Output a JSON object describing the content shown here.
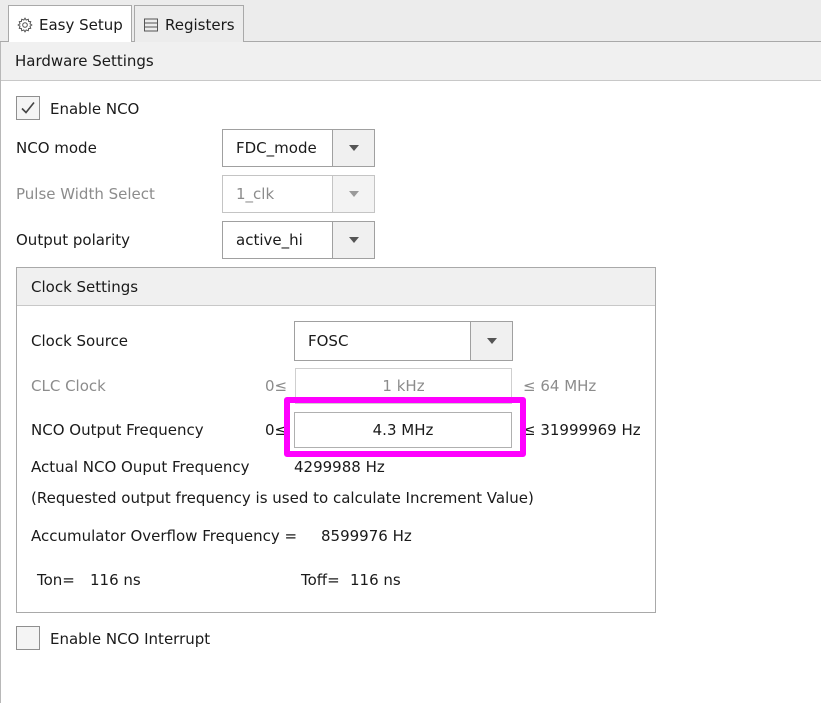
{
  "tabs": [
    {
      "label": "Easy Setup",
      "icon": "gear-icon",
      "active": true
    },
    {
      "label": "Registers",
      "icon": "list-icon",
      "active": false
    }
  ],
  "hardware": {
    "header": "Hardware Settings",
    "enable_nco": {
      "label": "Enable NCO",
      "checked": true
    },
    "nco_mode": {
      "label": "NCO mode",
      "value": "FDC_mode"
    },
    "pulse_width": {
      "label": "Pulse Width Select",
      "value": "1_clk",
      "disabled": true
    },
    "output_polarity": {
      "label": "Output polarity",
      "value": "active_hi"
    }
  },
  "clock": {
    "header": "Clock Settings",
    "source": {
      "label": "Clock Source",
      "value": "FOSC"
    },
    "clc_clock": {
      "label": "CLC Clock",
      "min": "0≤",
      "value": "1 kHz",
      "max": "≤ 64 MHz",
      "disabled": true
    },
    "nco_freq": {
      "label": "NCO Output Frequency",
      "min": "0≤",
      "value": "4.3 MHz",
      "max": "≤ 31999969 Hz"
    },
    "actual": {
      "label": "Actual NCO Ouput Frequency",
      "value": "4299988 Hz"
    },
    "note": "(Requested output frequency is used to calculate Increment Value)",
    "overflow": {
      "label": "Accumulator Overflow Frequency  =",
      "value": "8599976 Hz"
    },
    "ton": {
      "label": "Ton=",
      "value": "116 ns"
    },
    "toff": {
      "label": "Toff=",
      "value": "116 ns"
    }
  },
  "interrupt": {
    "label": "Enable NCO Interrupt",
    "checked": false
  },
  "colors": {
    "highlight": "#ff00ff"
  }
}
